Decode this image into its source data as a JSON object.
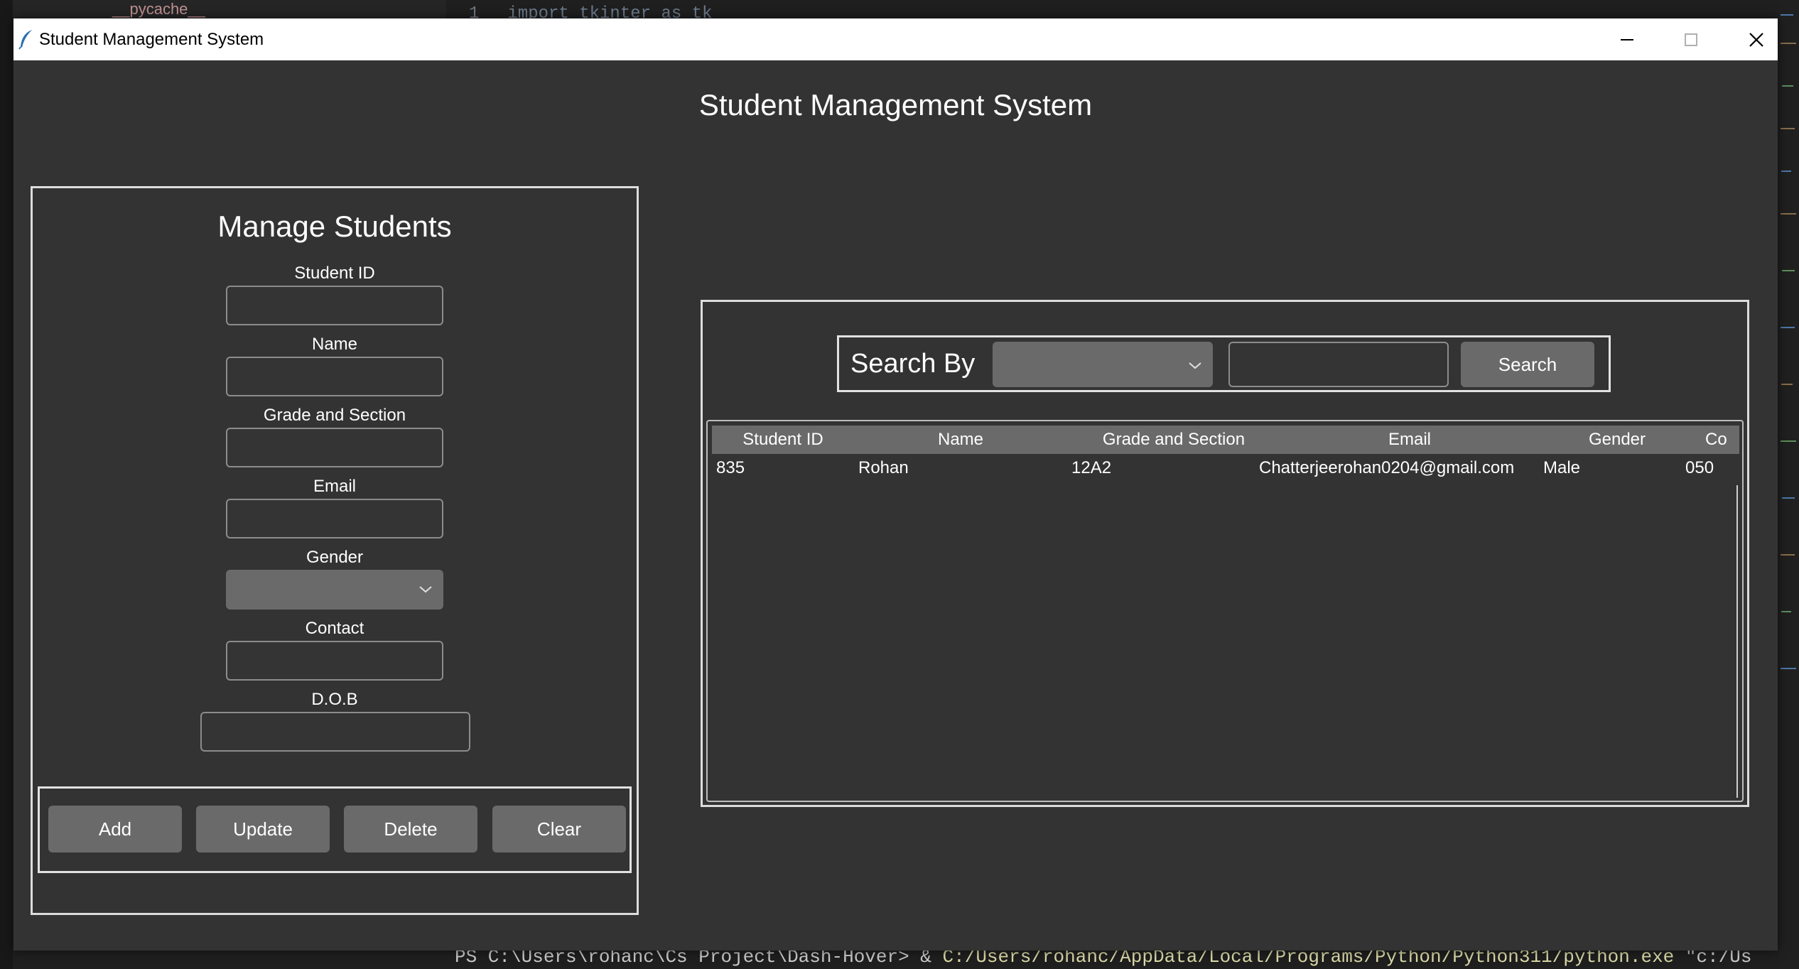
{
  "background": {
    "explorer_item": "__pycache__",
    "code_line_number": "1",
    "code_line": "import tkinter as tk",
    "terminal": {
      "prompt": "PS C:\\Users\\rohanc\\Cs Project\\Dash-Hover> & ",
      "path": "C:/Users/rohanc/AppData/Local/Programs/Python/Python311/python.exe",
      "tail": " \"c:/Us"
    }
  },
  "window": {
    "title": "Student Management System",
    "controls": {
      "minimize": "minimize-icon",
      "maximize": "maximize-icon",
      "close": "close-icon"
    }
  },
  "app": {
    "title": "Student Management System",
    "colors": {
      "background": "#333333",
      "button": "#6a6a6a",
      "text": "#ffffff",
      "border": "#dcdcdc"
    }
  },
  "manage": {
    "title": "Manage Students",
    "fields": [
      {
        "label": "Student ID",
        "value": ""
      },
      {
        "label": "Name",
        "value": ""
      },
      {
        "label": "Grade and Section",
        "value": ""
      },
      {
        "label": "Email",
        "value": ""
      },
      {
        "label": "Gender",
        "value": ""
      },
      {
        "label": "Contact",
        "value": ""
      },
      {
        "label": "D.O.B",
        "value": ""
      }
    ],
    "buttons": {
      "add": "Add",
      "update": "Update",
      "delete": "Delete",
      "clear": "Clear"
    }
  },
  "search": {
    "label": "Search By",
    "selected": "",
    "query": "",
    "button": "Search"
  },
  "table": {
    "columns": [
      "Student ID",
      "Name",
      "Grade and Section",
      "Email",
      "Gender",
      "Co"
    ],
    "rows": [
      [
        "835",
        "Rohan",
        "12A2",
        "Chatterjeerohan0204@gmail.com",
        "Male",
        "050"
      ]
    ]
  }
}
